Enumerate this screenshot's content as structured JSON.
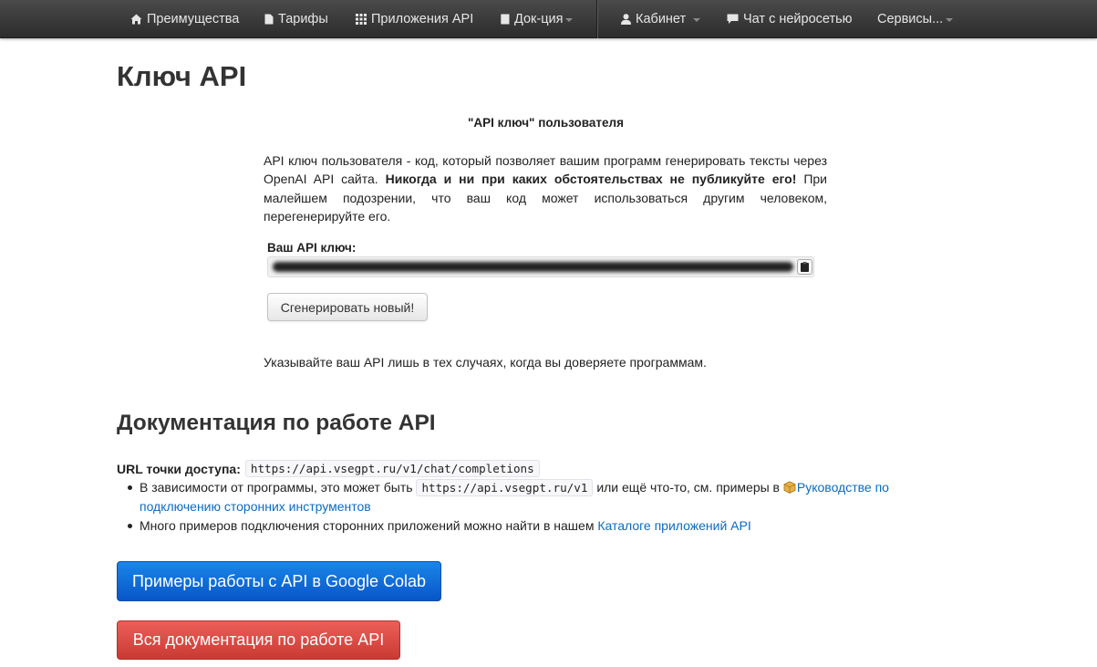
{
  "navbar": {
    "items": [
      {
        "label": "Преимущества",
        "icon": "home-icon"
      },
      {
        "label": "Тарифы",
        "icon": "file-icon"
      },
      {
        "label": "Приложения API",
        "icon": "grid-icon"
      },
      {
        "label": "Док-ция",
        "icon": "book-icon",
        "dropdown": true
      },
      {
        "label": "Кабинет",
        "icon": "user-icon",
        "dropdown": true
      },
      {
        "label": "Чат с нейросетью",
        "icon": "chat-icon"
      },
      {
        "label": "Сервисы...",
        "dropdown": true
      }
    ]
  },
  "page": {
    "title": "Ключ API"
  },
  "api_key_block": {
    "heading": "\"API ключ\" пользователя",
    "description_start": "API ключ пользователя - код, который позволяет вашим программ генерировать тексты через OpenAI API сайта. ",
    "description_bold": "Никогда и ни при каких обстоятельствах не публикуйте его!",
    "description_end": " При малейшем подозрении, что ваш код может использоваться другим человеком, перегенерируйте его.",
    "key_label": "Ваш API ключ:",
    "copy_icon": "clipboard-icon",
    "regenerate_button": "Сгенерировать новый!",
    "trust_note": "Указывайте ваш API лишь в тех случаях, когда вы доверяете программам."
  },
  "docs": {
    "title": "Документация по работе API",
    "endpoint_label": "URL точки доступа:",
    "endpoint_url": "https://api.vsegpt.ru/v1/chat/completions",
    "bullet1_text": "В зависимости от программы, это может быть",
    "bullet1_code": "https://api.vsegpt.ru/v1",
    "bullet1_text2": "или ещё что-то, см. примеры в",
    "bullet1_icon": "package-icon",
    "bullet1_link": "Руководстве по подключению сторонних инструментов",
    "bullet2_text": "Много примеров подключения сторонних приложений можно найти в нашем",
    "bullet2_link": "Каталоге приложений API",
    "colab_button": "Примеры работы с API в Google Colab",
    "all_docs_button": "Вся документация по работе API"
  },
  "colors": {
    "navbar": "#333333",
    "link": "#0a6cc2",
    "primary_button": "#0b63d6",
    "danger_button": "#d9453e"
  }
}
